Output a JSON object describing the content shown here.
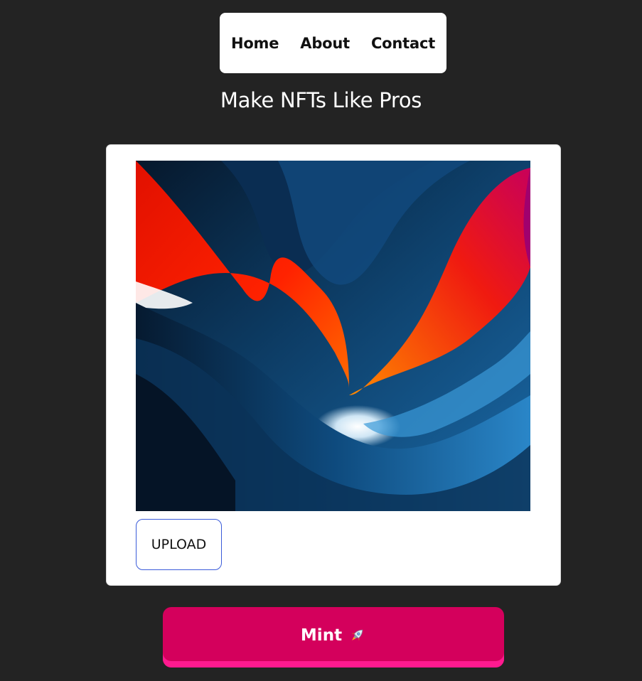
{
  "nav": {
    "items": [
      {
        "label": "Home"
      },
      {
        "label": "About"
      },
      {
        "label": "Contact"
      }
    ]
  },
  "hero": {
    "headline": "Make NFTs Like Pros"
  },
  "upload_card": {
    "image_icon": "abstract-canyon-artwork",
    "upload_label": "UPLOAD"
  },
  "mint": {
    "label": "Mint",
    "icon": "rocket-icon"
  },
  "colors": {
    "background": "#232323",
    "card": "#ffffff",
    "upload_border": "#3a5bd9",
    "mint_button": "#d4005c",
    "mint_button_edge": "#ff1a8f"
  }
}
